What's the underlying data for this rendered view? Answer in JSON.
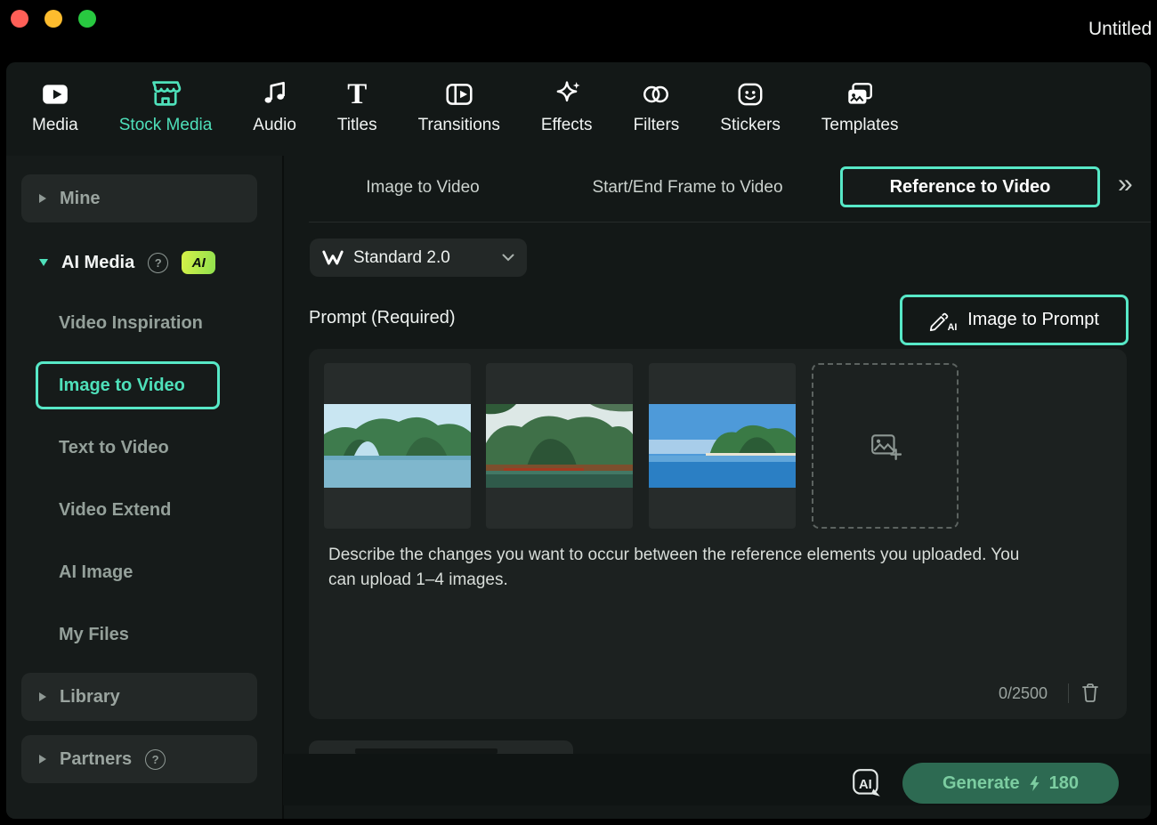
{
  "window": {
    "title": "Untitled"
  },
  "ui": {
    "help_glyph": "?",
    "overflow_glyph": "»"
  },
  "nav": {
    "active": "Stock Media",
    "items": [
      {
        "label": "Media"
      },
      {
        "label": "Stock Media"
      },
      {
        "label": "Audio"
      },
      {
        "label": "Titles"
      },
      {
        "label": "Transitions"
      },
      {
        "label": "Effects"
      },
      {
        "label": "Filters"
      },
      {
        "label": "Stickers"
      },
      {
        "label": "Templates"
      }
    ]
  },
  "sidebar": {
    "mine": "Mine",
    "ai_media": "AI Media",
    "ai_badge": "AI",
    "items": [
      "Video Inspiration",
      "Image to Video",
      "Text to Video",
      "Video Extend",
      "AI Image",
      "My Files"
    ],
    "selected": "Image to Video",
    "library": "Library",
    "partners": "Partners"
  },
  "tabs": {
    "items": [
      "Image to Video",
      "Start/End Frame to Video",
      "Reference to Video"
    ],
    "active": "Reference to Video"
  },
  "model": {
    "value": "Standard 2.0"
  },
  "prompt": {
    "label": "Prompt (Required)",
    "image_to_prompt_label": "Image to Prompt",
    "uploaded_images": [
      "reference-image-1",
      "reference-image-2",
      "reference-image-3"
    ],
    "description": "Describe the changes you want to occur between the reference elements you uploaded. You can upload 1–4 images.",
    "char_count": "0/2500"
  },
  "footer": {
    "generate_label": "Generate",
    "credits": "180"
  },
  "colors": {
    "accent": "#4ee0ba",
    "highlight_border": "#57e8c7",
    "generate_bg": "#2d6a52",
    "generate_text": "#7ccda1"
  }
}
